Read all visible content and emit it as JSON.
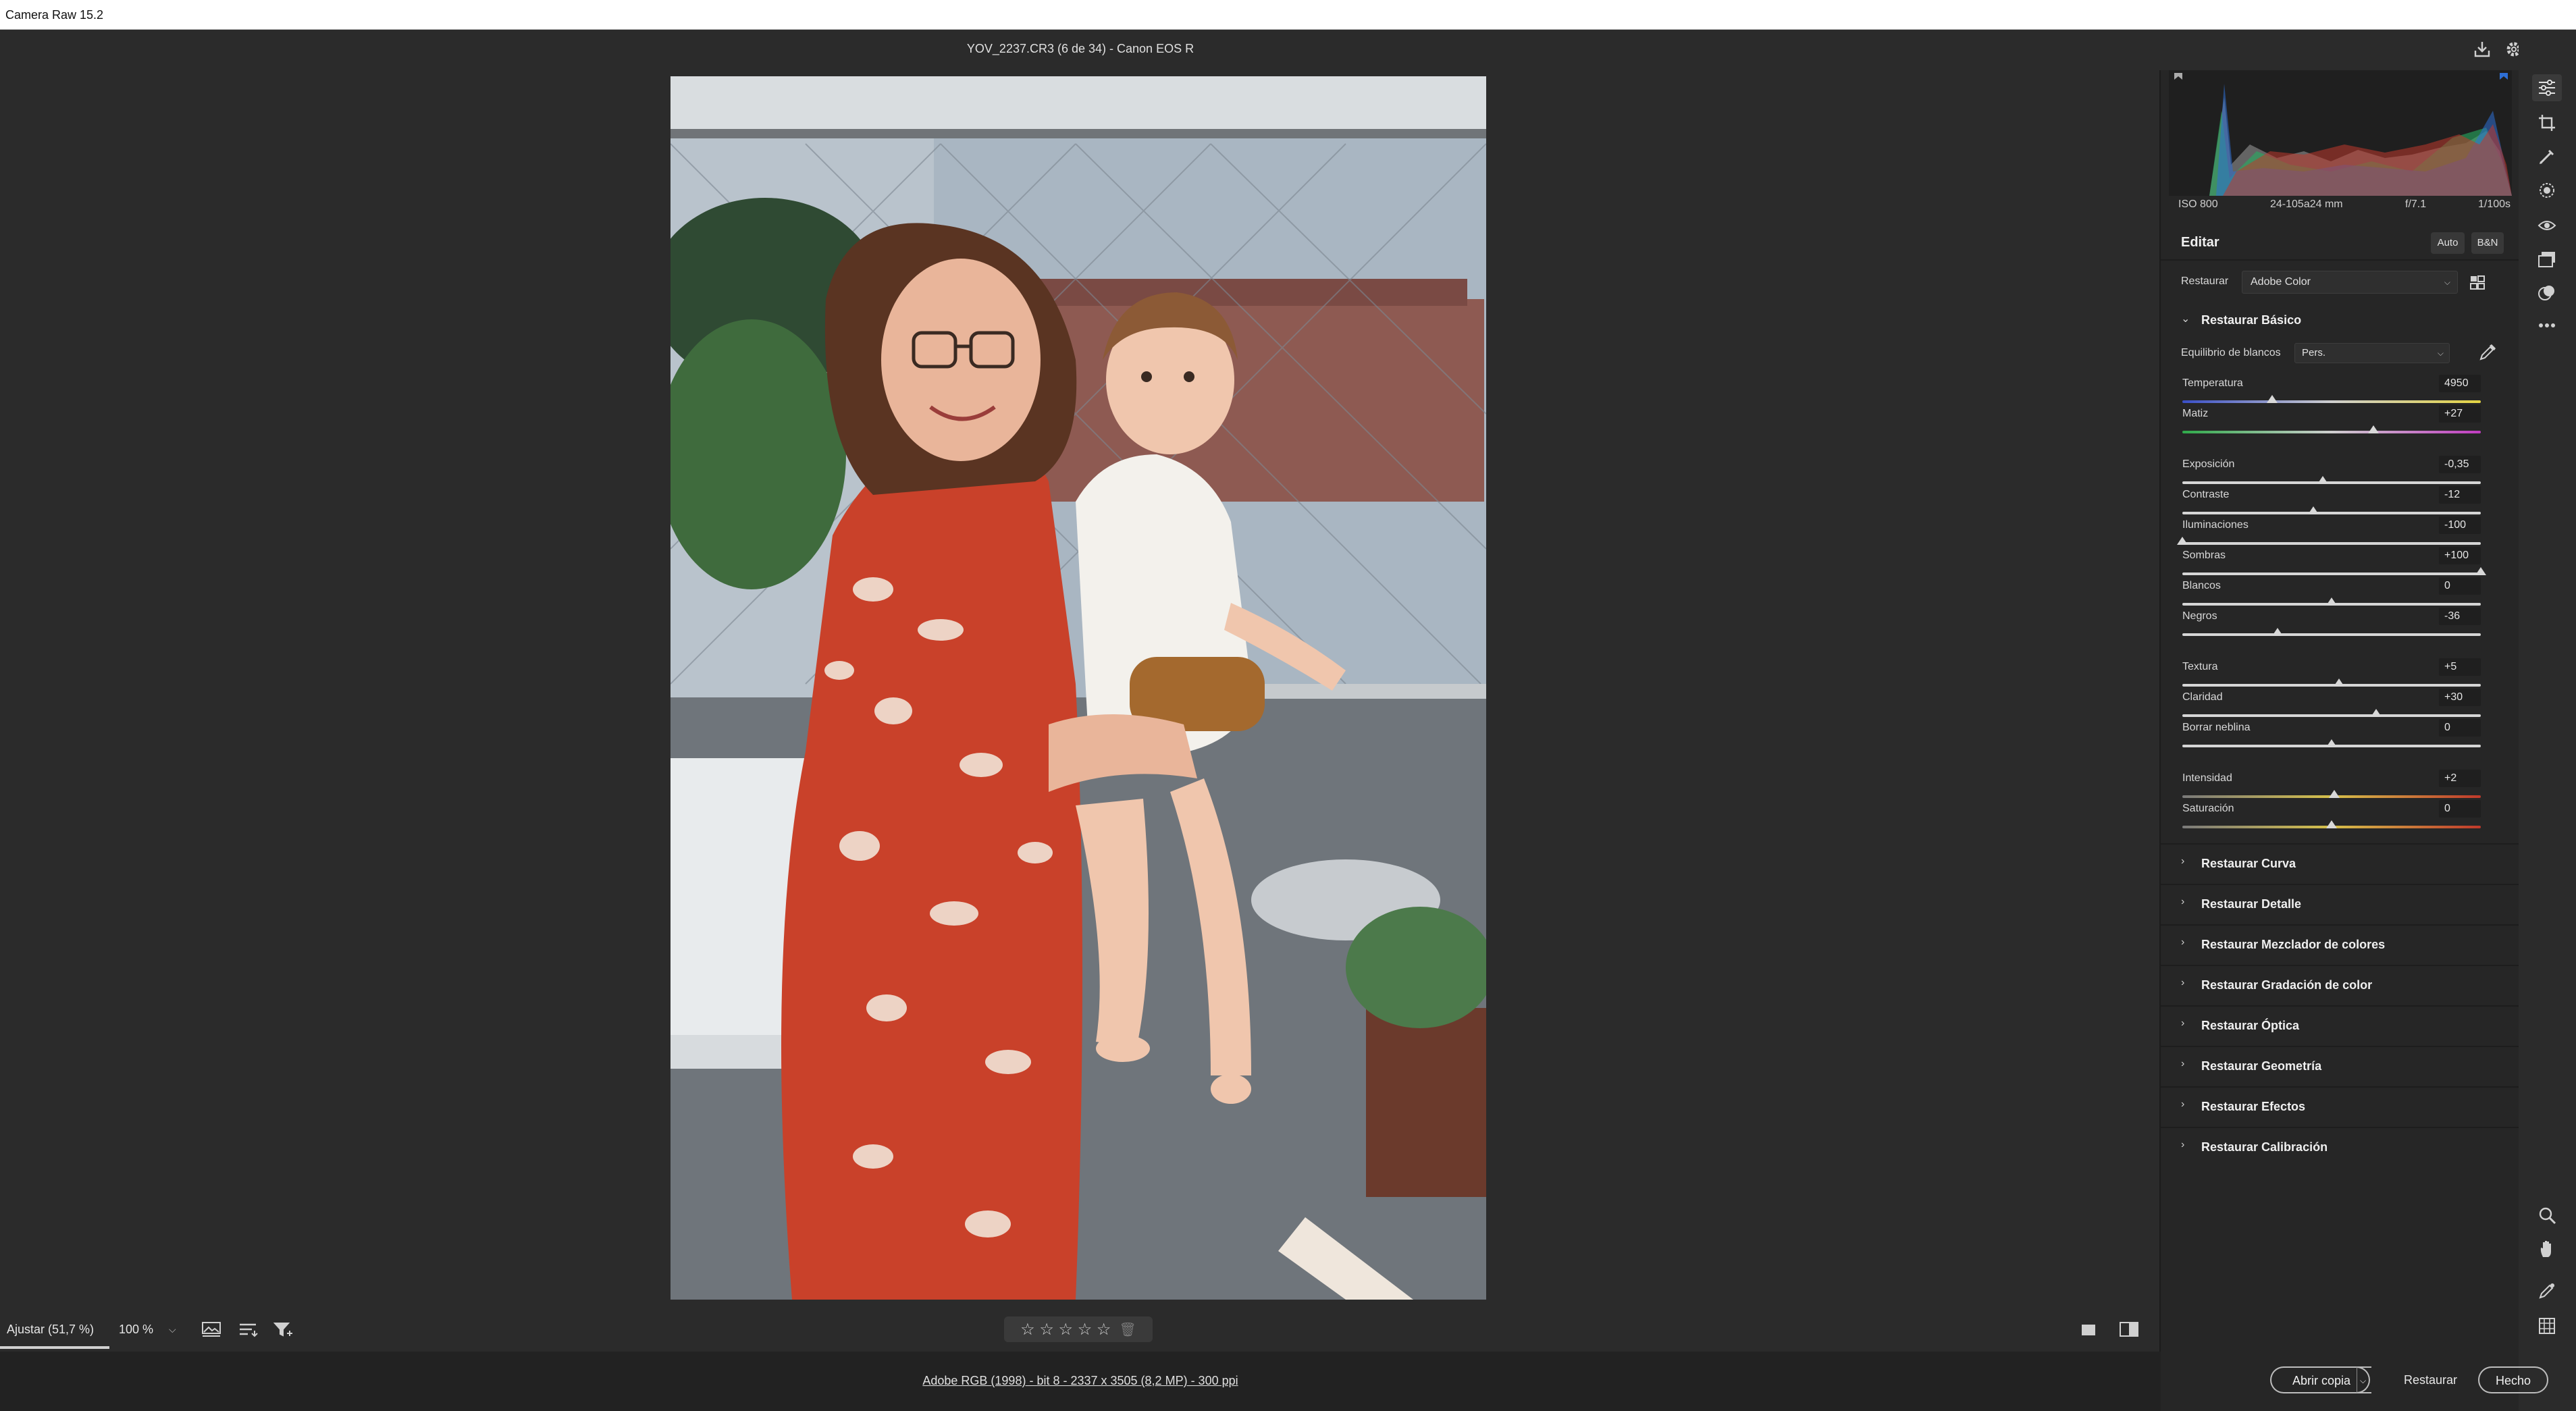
{
  "window": {
    "title": "Camera Raw 15.2"
  },
  "header": {
    "filename": "YOV_2237.CR3 (6 de 34) -  Canon EOS R"
  },
  "histogram": {
    "iso": "ISO 800",
    "lens": "24-105a24 mm",
    "aperture": "f/7.1",
    "shutter": "1/100s",
    "colors": {
      "red": "#c0392b",
      "green": "#27ae60",
      "blue": "#2e6fd6"
    }
  },
  "edit": {
    "title": "Editar",
    "auto_label": "Auto",
    "bw_label": "B&N",
    "profile_label": "Restaurar",
    "profile_value": "Adobe Color"
  },
  "basic": {
    "title": "Restaurar Básico",
    "wb_label": "Equilibrio de blancos",
    "wb_value": "Pers.",
    "sliders": [
      {
        "label": "Temperatura",
        "value": "4950",
        "pos": 0.3
      },
      {
        "label": "Matiz",
        "value": "+27",
        "pos": 0.64
      },
      {
        "label": "Exposición",
        "value": "-0,35",
        "pos": 0.47
      },
      {
        "label": "Contraste",
        "value": "-12",
        "pos": 0.44
      },
      {
        "label": "Iluminaciones",
        "value": "-100",
        "pos": 0.0
      },
      {
        "label": "Sombras",
        "value": "+100",
        "pos": 1.0
      },
      {
        "label": "Blancos",
        "value": "0",
        "pos": 0.5
      },
      {
        "label": "Negros",
        "value": "-36",
        "pos": 0.32
      },
      {
        "label": "Textura",
        "value": "+5",
        "pos": 0.525
      },
      {
        "label": "Claridad",
        "value": "+30",
        "pos": 0.65
      },
      {
        "label": "Borrar neblina",
        "value": "0",
        "pos": 0.5
      },
      {
        "label": "Intensidad",
        "value": "+2",
        "pos": 0.51
      },
      {
        "label": "Saturación",
        "value": "0",
        "pos": 0.5
      }
    ]
  },
  "sections": [
    {
      "label": "Restaurar Curva"
    },
    {
      "label": "Restaurar Detalle"
    },
    {
      "label": "Restaurar Mezclador de colores"
    },
    {
      "label": "Restaurar Gradación de color"
    },
    {
      "label": "Restaurar Óptica"
    },
    {
      "label": "Restaurar Geometría"
    },
    {
      "label": "Restaurar Efectos"
    },
    {
      "label": "Restaurar Calibración"
    }
  ],
  "bottom": {
    "zoom_fit": "Ajustar (51,7 %)",
    "zoom_percent": "100 %",
    "rating": "☆ ☆ ☆ ☆ ☆",
    "info_link": "Adobe RGB (1998) - bit 8 - 2337 x 3505 (8,2 MP) - 300 ppi"
  },
  "footer": {
    "open_copy": "Abrir copia",
    "reset": "Restaurar",
    "done": "Hecho"
  }
}
